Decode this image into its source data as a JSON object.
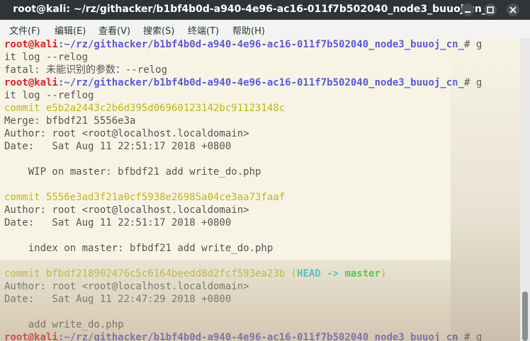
{
  "window": {
    "title": "root@kali: ~/rz/githacker/b1bf4b0d-a940-4e96-ac16-011f7b502040_node3_buuoj_cn_",
    "buttons": {
      "minimize": "minimize-icon",
      "maximize": "maximize-icon",
      "close": "close-icon"
    }
  },
  "menu": {
    "items": [
      "文件(F)",
      "编辑(E)",
      "查看(V)",
      "搜索(S)",
      "终端(T)",
      "帮助(H)"
    ]
  },
  "colors": {
    "prompt_user": "#d8232a",
    "prompt_path": "#5a5ad8",
    "commit_hash": "#c2b51a",
    "head_ref": "#1fc5c5",
    "branch_ref": "#22cc22",
    "terminal_bg": "#f7f4e6",
    "titlebar_bg": "#2f3436"
  },
  "terminal": {
    "lines": [
      {
        "user": "root@kali",
        "path": ":~/rz/githacker/b1bf4b0d-a940-4e96-ac16-011f7b502040_node3_buuoj_cn_",
        "symbol": "# g"
      },
      {
        "text": "it log --relog"
      },
      {
        "text": "fatal: 未能识别的参数：--relog"
      },
      {
        "user": "root@kali",
        "path": ":~/rz/githacker/b1bf4b0d-a940-4e96-ac16-011f7b502040_node3_buuoj_cn_",
        "symbol": "# g"
      },
      {
        "text": "it log --reflog"
      },
      {
        "commit": "commit e5b2a2443c2b6d395d06960123142bc91123148c"
      },
      {
        "text": "Merge: bfbdf21 5556e3a"
      },
      {
        "text": "Author: root <root@localhost.localdomain>"
      },
      {
        "text": "Date:   Sat Aug 11 22:51:17 2018 +0800"
      },
      {
        "text": ""
      },
      {
        "text": "    WIP on master: bfbdf21 add write_do.php"
      },
      {
        "text": ""
      },
      {
        "commit": "commit 5556e3ad3f21a0cf5938e26985a04ce3aa73faaf"
      },
      {
        "text": "Author: root <root@localhost.localdomain>"
      },
      {
        "text": "Date:   Sat Aug 11 22:51:17 2018 +0800"
      },
      {
        "text": ""
      },
      {
        "text": "    index on master: bfbdf21 add write_do.php"
      },
      {
        "text": ""
      },
      {
        "commit": "commit bfbdf218902476c5c6164beedd8d2fcf593ea23b",
        "ref_open": " (",
        "head": "HEAD -> ",
        "branch": "master",
        "ref_close": ")"
      },
      {
        "text": "Author: root <root@localhost.localdomain>"
      },
      {
        "text": "Date:   Sat Aug 11 22:47:29 2018 +0800"
      },
      {
        "text": ""
      },
      {
        "text": "    add write_do.php"
      },
      {
        "user": "root@kali",
        "path": ":~/rz/githacker/b1bf4b0d-a940-4e96-ac16-011f7b502040_node3_buuoj_cn_",
        "symbol": "# g"
      }
    ]
  }
}
